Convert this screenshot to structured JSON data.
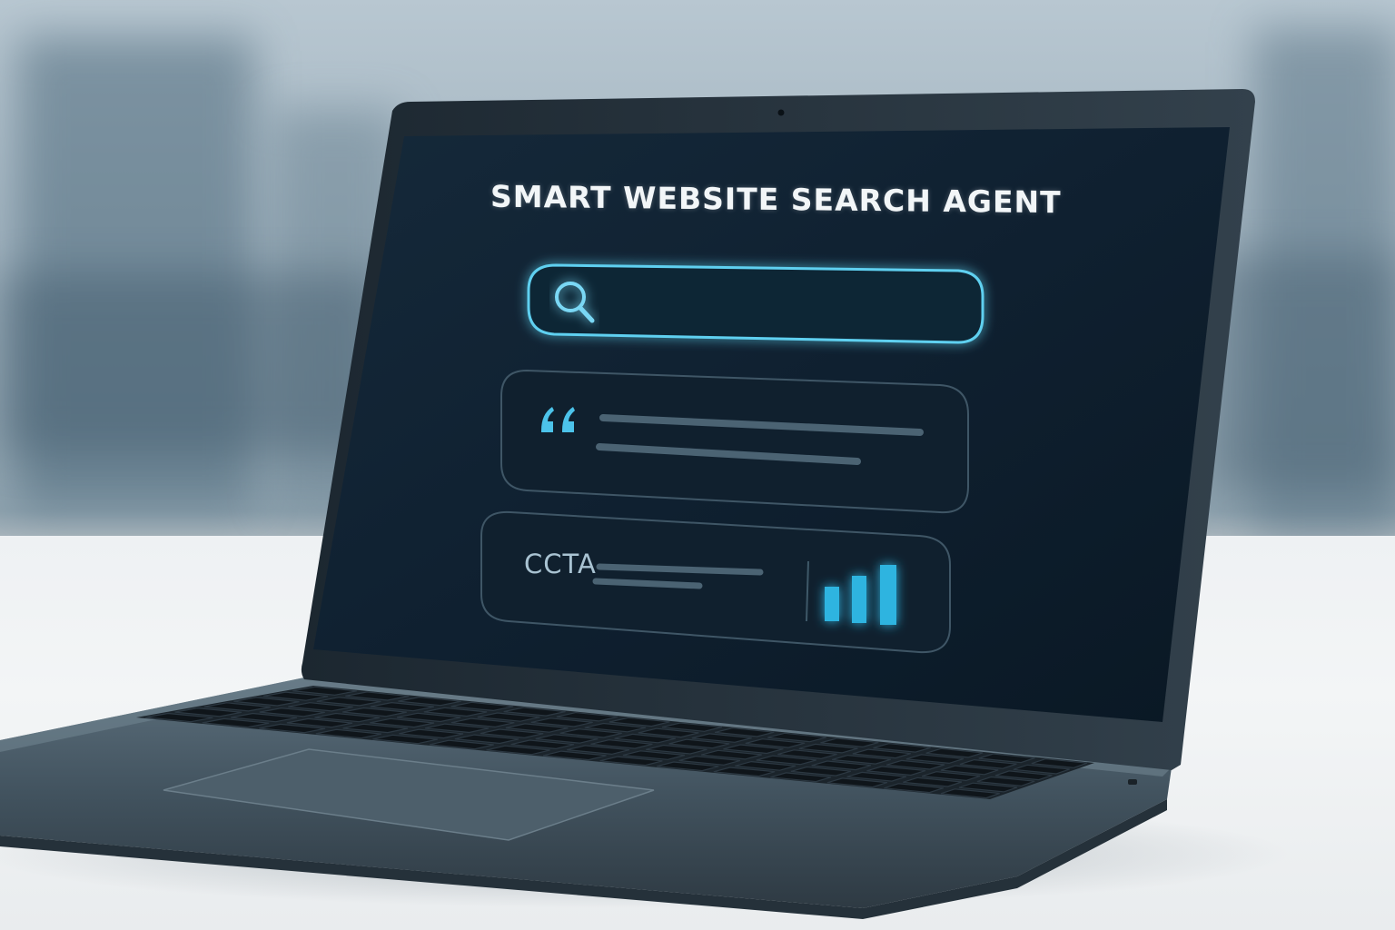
{
  "screen": {
    "title": "SMART WEBSITE SEARCH AGENT",
    "search_field": {
      "icon": "search-icon",
      "value": ""
    },
    "quote_card": {
      "icon": "quote-icon"
    },
    "cta_card": {
      "label": "CCTA",
      "chart_icon": "bar-chart-icon"
    }
  },
  "colors": {
    "accent": "#5fd0f0",
    "screen_bg": "#0f2233",
    "bars": "#2fb4e0"
  }
}
